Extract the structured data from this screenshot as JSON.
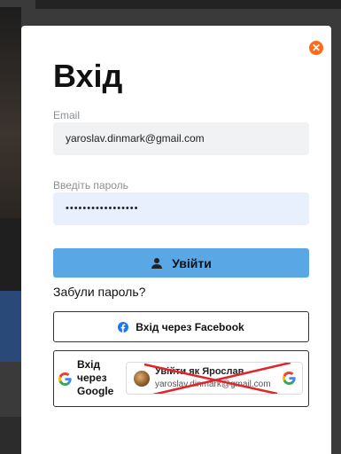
{
  "modal": {
    "title": "Вхід",
    "email_label": "Email",
    "email_value": "yaroslav.dinmark@gmail.com",
    "password_label": "Введіть пароль",
    "password_value": "•••••••••••••••••",
    "login_button": "Увійти",
    "forgot_password": "Забули пароль?",
    "facebook_button": "Вхід через Facebook",
    "google_label": "Вхід через Google",
    "google_account": {
      "name": "Увійти як Ярослав",
      "email": "yaroslav.dinmark@gmail.com"
    }
  },
  "colors": {
    "accent": "#5aa7e6",
    "close": "#ff6a1a",
    "cross": "#e0242a"
  }
}
